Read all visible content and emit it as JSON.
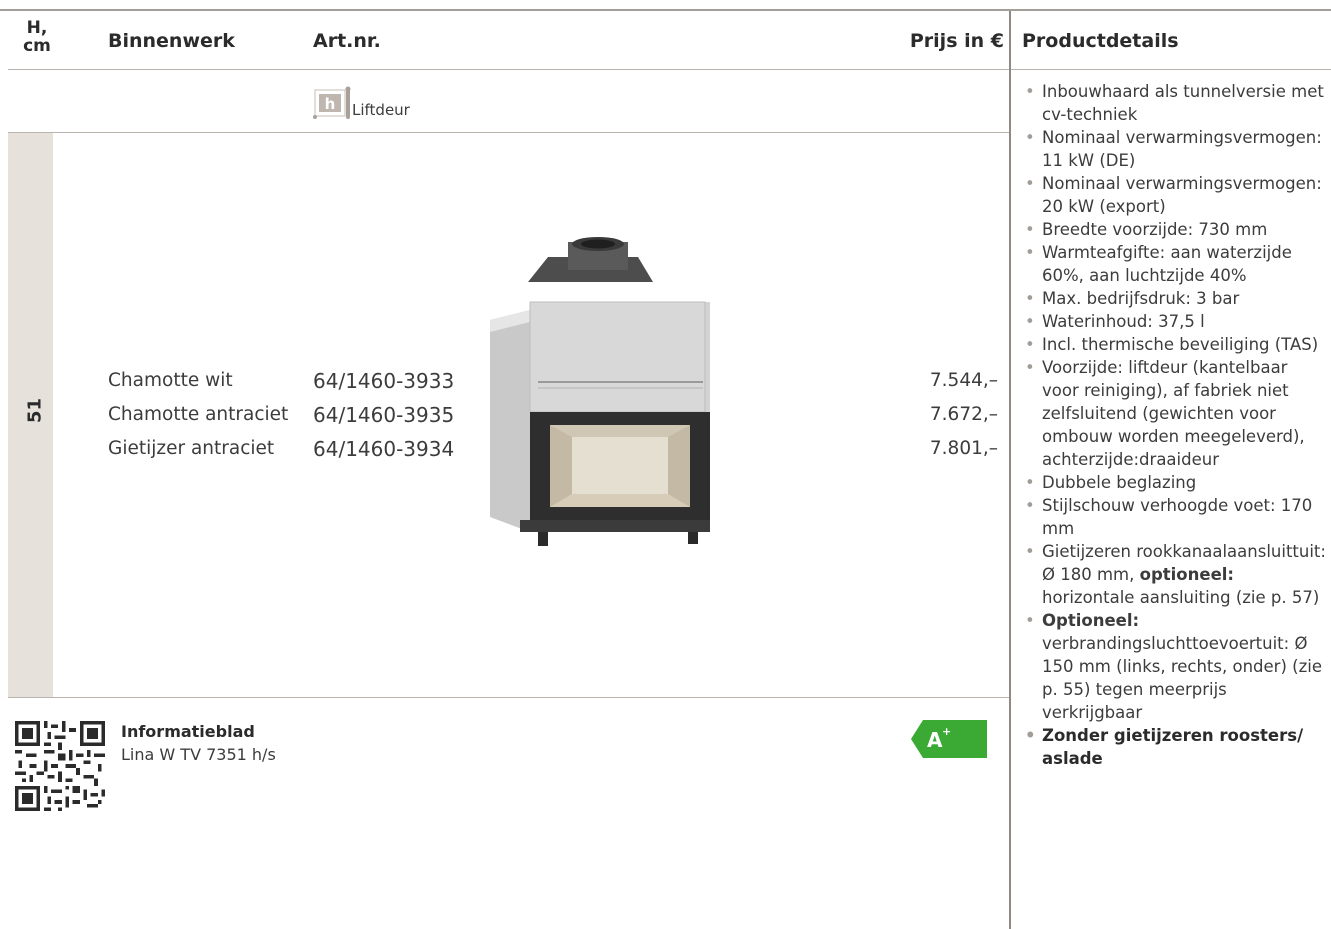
{
  "header": {
    "height_label": "H,\ncm",
    "binnenwerk": "Binnenwerk",
    "artnr": "Art.nr.",
    "price": "Prijs in €",
    "details": "Productdetails"
  },
  "door_type": {
    "icon_letter": "h",
    "label": "Liftdeur"
  },
  "height_value": "51",
  "rows": [
    {
      "binnenwerk": "Chamotte wit",
      "artnr": "64/1460-3933",
      "price": "7.544,–"
    },
    {
      "binnenwerk": "Chamotte antraciet",
      "artnr": "64/1460-3935",
      "price": "7.672,–"
    },
    {
      "binnenwerk": "Gietijzer antraciet",
      "artnr": "64/1460-3934",
      "price": "7.801,–"
    }
  ],
  "details": [
    {
      "text": "Inbouwhaard als tunnelversie met cv-techniek"
    },
    {
      "text": "Nominaal verwarmingsvermogen: 11 kW (DE)"
    },
    {
      "text": "Nominaal verwarmingsvermogen: 20 kW (export)"
    },
    {
      "text": "Breedte voorzijde: 730 mm"
    },
    {
      "text": "Warmteafgifte: aan waterzijde 60%, aan luchtzijde 40%"
    },
    {
      "text": "Max. bedrijfsdruk: 3 bar"
    },
    {
      "text": "Waterinhoud: 37,5 l"
    },
    {
      "text": "Incl. thermische beveiliging (TAS)"
    },
    {
      "text": "Voorzijde: liftdeur (kantelbaar voor reiniging), af fabriek niet zelfsluitend (gewichten voor ombouw worden meegeleverd), achterzijde:draaideur"
    },
    {
      "text": "Dubbele beglazing"
    },
    {
      "text": "Stijlschouw verhoogde voet: 170 mm"
    },
    {
      "text_before": "Gietijzeren rookkanaalaansluittuit: Ø 180 mm, ",
      "text_bold": "optioneel:",
      "text_after": " horizontale aansluiting (zie p. 57)"
    },
    {
      "text_bold": "Optioneel:",
      "text_after": " verbrandingsluchttoevoertuit: Ø 150 mm (links, rechts, onder) (zie p. 55) tegen meerprijs verkrijgbaar"
    },
    {
      "text": "Zonder gietijzeren roosters/ aslade",
      "bold": true
    }
  ],
  "info": {
    "title": "Informatieblad",
    "model": "Lina W TV 7351 h/s"
  },
  "energy_label": {
    "class": "A",
    "sup": "+",
    "color": "#3aaa35"
  },
  "colors": {
    "sidebar": "#e6e1db",
    "rule": "#a49e98"
  }
}
